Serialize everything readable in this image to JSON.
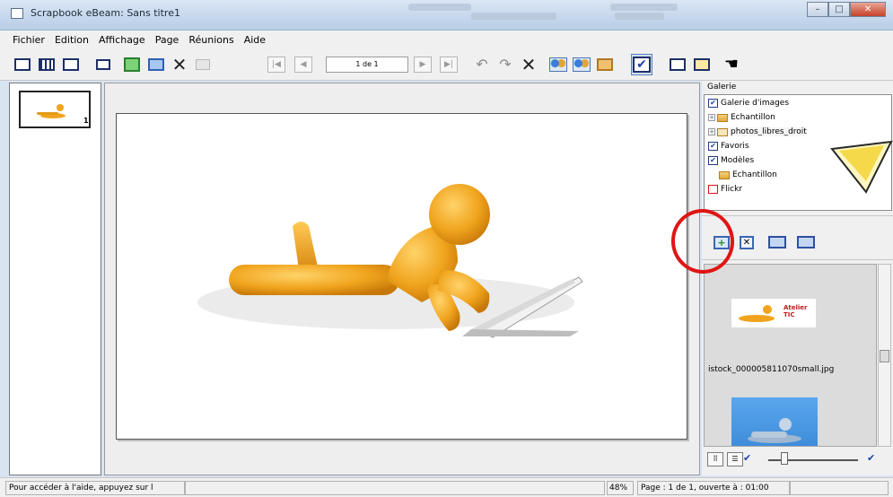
{
  "window": {
    "title": "Scrapbook eBeam: Sans titre1"
  },
  "menu": [
    "Fichier",
    "Edition",
    "Affichage",
    "Page",
    "Réunions",
    "Aide"
  ],
  "toolbar": {
    "page_indicator": "1 de 1"
  },
  "thumbnails": [
    {
      "number": "1"
    }
  ],
  "gallery": {
    "header": "Galerie",
    "tree": [
      {
        "label": "Galerie d'images",
        "checked": true
      },
      {
        "label": "Echantillon"
      },
      {
        "label": "photos_libres_droit"
      },
      {
        "label": "Favoris",
        "checked": true
      },
      {
        "label": "Modèles",
        "checked": true
      },
      {
        "label": "Echantillon"
      },
      {
        "label": "Flickr"
      }
    ],
    "items": [
      {
        "badge": "Atelier TIC"
      },
      {
        "caption": "istock_000005811070small.jpg"
      }
    ]
  },
  "status": {
    "help": "Pour accéder à l'aide, appuyez sur l",
    "zoom": "48%",
    "page_info": "Page : 1 de 1, ouverte à : 01:00"
  },
  "colors": {
    "highlight_circle": "#e01515",
    "figure": "#f0a41d",
    "accent": "#1e3fae"
  }
}
